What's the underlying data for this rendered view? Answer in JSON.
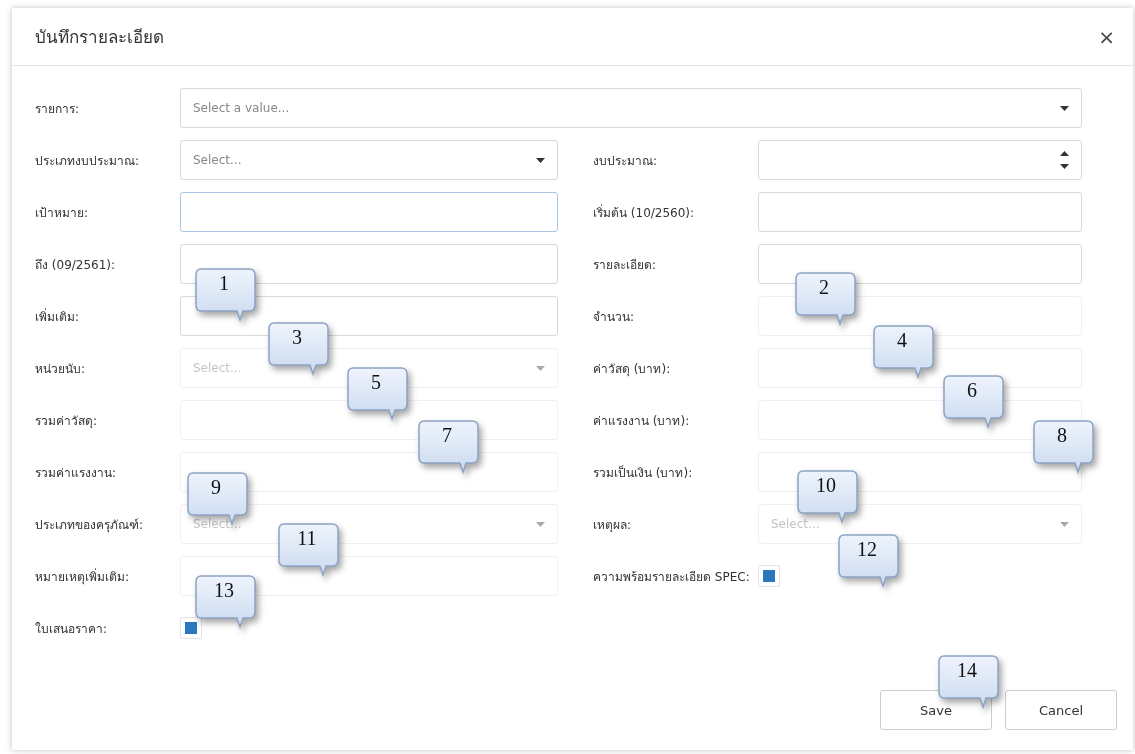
{
  "dialog": {
    "title": "บันทึกรายละเอียด",
    "close": "×"
  },
  "rows": [
    {
      "full": true,
      "fields": [
        {
          "label": "รายการ:",
          "kind": "select",
          "placeholder": "Select a value...",
          "disabled": false,
          "focused": false
        }
      ]
    },
    {
      "fields": [
        {
          "label": "ประเภทงบประมาณ:",
          "kind": "select",
          "placeholder": "Select...",
          "disabled": false,
          "focused": false
        },
        {
          "label": "งบประมาณ:",
          "kind": "number",
          "disabled": false,
          "focused": false
        }
      ]
    },
    {
      "fields": [
        {
          "label": "เป้าหมาย:",
          "kind": "text",
          "disabled": false,
          "focused": true
        },
        {
          "label": "เริ่มต้น (10/2560):",
          "kind": "text",
          "disabled": false,
          "focused": false
        }
      ]
    },
    {
      "fields": [
        {
          "label": "ถึง (09/2561):",
          "kind": "text",
          "disabled": false,
          "focused": false
        },
        {
          "label": "รายละเอียด:",
          "kind": "text",
          "disabled": false,
          "focused": false
        }
      ]
    },
    {
      "fields": [
        {
          "label": "เพิ่มเติม:",
          "kind": "text",
          "disabled": false,
          "focused": false
        },
        {
          "label": "จำนวน:",
          "kind": "text",
          "disabled": true,
          "focused": false
        }
      ]
    },
    {
      "fields": [
        {
          "label": "หน่วยนับ:",
          "kind": "select",
          "placeholder": "Select...",
          "disabled": true,
          "focused": false
        },
        {
          "label": "ค่าวัสดุ (บาท):",
          "kind": "text",
          "disabled": true,
          "focused": false
        }
      ]
    },
    {
      "fields": [
        {
          "label": "รวมค่าวัสดุ:",
          "kind": "text",
          "disabled": true,
          "focused": false
        },
        {
          "label": "ค่าแรงงาน (บาท):",
          "kind": "text",
          "disabled": true,
          "focused": false
        }
      ]
    },
    {
      "fields": [
        {
          "label": "รวมค่าแรงงาน:",
          "kind": "text",
          "disabled": true,
          "focused": false
        },
        {
          "label": "รวมเป็นเงิน (บาท):",
          "kind": "text",
          "disabled": true,
          "focused": false
        }
      ]
    },
    {
      "fields": [
        {
          "label": "ประเภทของครุภัณฑ์:",
          "kind": "select",
          "placeholder": "Select...",
          "disabled": true,
          "focused": false
        },
        {
          "label": "เหตุผล:",
          "kind": "select",
          "placeholder": "Select...",
          "disabled": true,
          "focused": false
        }
      ]
    },
    {
      "fields": [
        {
          "label": "หมายเหตุเพิ่มเติม:",
          "kind": "text",
          "disabled": true,
          "focused": false
        },
        {
          "label": "ความพร้อมรายละเอียด SPEC:",
          "kind": "checkbox",
          "checked": true
        }
      ]
    },
    {
      "fields": [
        {
          "label": "ใบเสนอราคา:",
          "kind": "checkbox",
          "checked": true
        }
      ]
    }
  ],
  "buttons": [
    {
      "label": "Save"
    },
    {
      "label": "Cancel"
    }
  ],
  "callouts": [
    "1",
    "2",
    "3",
    "4",
    "5",
    "6",
    "7",
    "8",
    "9",
    "10",
    "11",
    "12",
    "13",
    "14"
  ]
}
